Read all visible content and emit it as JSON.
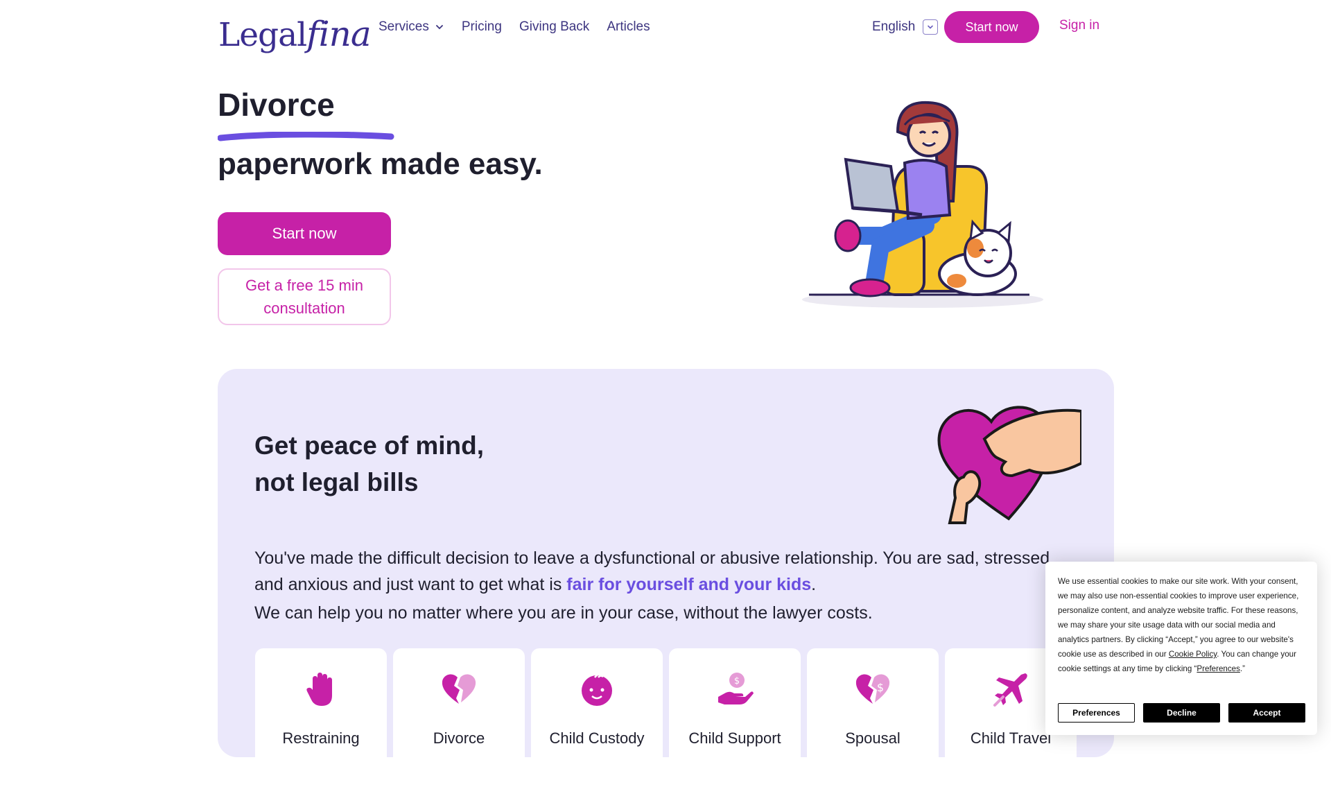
{
  "header": {
    "logo_part1": "Legal",
    "logo_part2": "fina",
    "nav": [
      {
        "label": "Services",
        "has_dropdown": true
      },
      {
        "label": "Pricing"
      },
      {
        "label": "Giving Back"
      },
      {
        "label": "Articles"
      }
    ],
    "language": "English",
    "start_label": "Start now",
    "signin_label": "Sign in"
  },
  "hero": {
    "title": "Divorce",
    "subtitle": "paperwork made easy.",
    "start_label": "Start now",
    "consult_label": "Get a free 15 min consultation"
  },
  "panel": {
    "title_line1": "Get peace of mind,",
    "title_line2": "not legal bills",
    "para1_a": "You've made the difficult decision to leave a dysfunctional or abusive relationship. You are sad, stressed, and anxious and just want to get what is ",
    "para1_highlight": "fair for yourself and your kids",
    "para1_b": ".",
    "para2": "We can help you no matter where you are in your case, without the lawyer costs.",
    "cards": [
      {
        "label": "Restraining",
        "icon": "hand-icon"
      },
      {
        "label": "Divorce",
        "icon": "broken-heart-icon"
      },
      {
        "label": "Child Custody",
        "icon": "baby-icon"
      },
      {
        "label": "Child Support",
        "icon": "money-hand-icon"
      },
      {
        "label": "Spousal",
        "icon": "broken-heart-dollar-icon"
      },
      {
        "label": "Child Travel",
        "icon": "airplane-icon"
      }
    ]
  },
  "cookie": {
    "text_a": "We use essential cookies to make our site work. With your consent, we may also use non-essential cookies to improve user experience, personalize content, and analyze website traffic. For these reasons, we may share your site usage data with our social media and analytics partners. By clicking “Accept,” you agree to our website's cookie use as described in our ",
    "policy_link": "Cookie Policy",
    "text_b": ". You can change your cookie settings at any time by clicking “",
    "pref_link": "Preferences",
    "text_c": ".”",
    "preferences_btn": "Preferences",
    "decline_btn": "Decline",
    "accept_btn": "Accept"
  },
  "colors": {
    "brand_magenta": "#c621a7",
    "brand_purple": "#3a2d8f",
    "panel_bg": "#ebe8fb",
    "highlight": "#6a4ee0"
  }
}
